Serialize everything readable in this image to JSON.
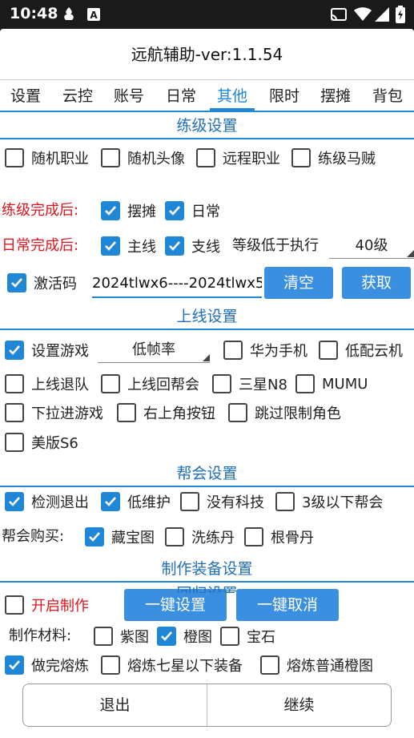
{
  "status": {
    "time": "10:48"
  },
  "title": "远航辅助-ver:1.1.54",
  "tabs": [
    "设置",
    "云控",
    "账号",
    "日常",
    "其他",
    "限时",
    "摆摊",
    "背包"
  ],
  "active_tab": "其他",
  "sec_level": {
    "title": "练级设置",
    "opts": [
      "随机职业",
      "随机头像",
      "远程职业",
      "练级马贼"
    ],
    "after_label": "练级完成后:",
    "after": [
      "摆摊",
      "日常"
    ],
    "daily_label": "日常完成后:",
    "daily": [
      "主线",
      "支线"
    ],
    "level_label": "等级低于执行",
    "level_value": "40级",
    "code_label": "激活码",
    "code_value": "2024tlwx6----2024tlwx5",
    "clear_btn": "清空",
    "get_btn": "获取"
  },
  "sec_online": {
    "title": "上线设置",
    "set_game": "设置游戏",
    "fps_value": "低帧率",
    "huawei": "华为手机",
    "lowcloud": "低配云机",
    "quit_team": "上线退队",
    "back_guild": "上线回帮会",
    "samsung": "三星N8",
    "mumu": "MUMU",
    "pull_enter": "下拉进游戏",
    "top_right": "右上角按钮",
    "skip_limit": "跳过限制角色",
    "us_s6": "美版S6"
  },
  "sec_guild": {
    "title": "帮会设置",
    "detect_quit": "检测退出",
    "low_maint": "低维护",
    "no_tech": "没有科技",
    "below3": "3级以下帮会",
    "buy_label": "帮会购买:",
    "treasure": "藏宝图",
    "wash_pill": "洗练丹",
    "root_pill": "根骨丹"
  },
  "sec_make": {
    "title": "制作装备设置",
    "enable": "开启制作",
    "setup_btn": "一键设置",
    "cancel_btn": "一键取消",
    "mat_label": "制作材料:",
    "purple": "紫图",
    "orange": "橙图",
    "gem": "宝石",
    "smelt_done": "做完熔炼",
    "smelt_7": "熔炼七星以下装备",
    "smelt_orange": "熔炼普通橙图"
  },
  "peek_title": "回归设置",
  "footer": {
    "exit": "退出",
    "continue": "继续"
  }
}
